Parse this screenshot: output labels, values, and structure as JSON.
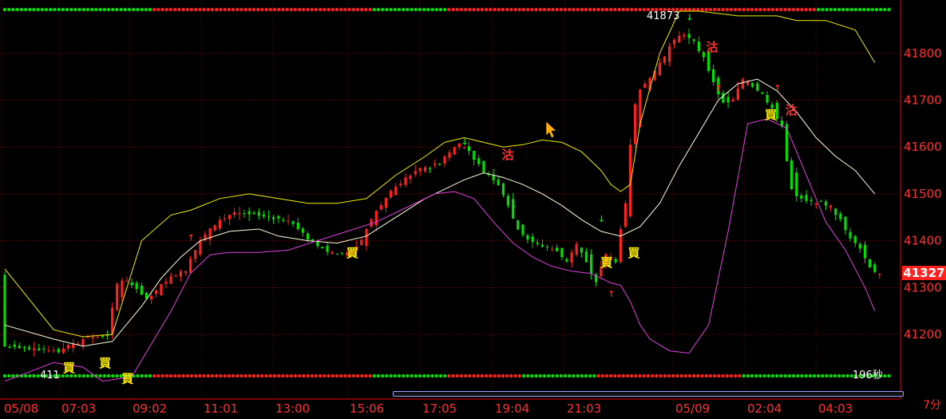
{
  "chart_data": {
    "type": "candlestick",
    "timeframe": "7分",
    "last_price": "41327",
    "high_label": "41873",
    "low_label": "411",
    "right_bottom_label": "196秒",
    "y_ticks": [
      41200,
      41300,
      41400,
      41500,
      41600,
      41700,
      41800
    ],
    "ylim": [
      41120,
      41890
    ],
    "x_ticks": [
      "05/08",
      "07:03",
      "09:02",
      "11:01",
      "13:00",
      "15:06",
      "17:05",
      "19:04",
      "21:03",
      "05/09",
      "02:04",
      "04:03"
    ],
    "close_path": [
      [
        0,
        41175
      ],
      [
        4,
        41170
      ],
      [
        6,
        41165
      ],
      [
        9,
        41195
      ],
      [
        11,
        41195
      ],
      [
        12,
        41320
      ],
      [
        14,
        41300
      ],
      [
        15,
        41270
      ],
      [
        17,
        41320
      ],
      [
        19,
        41340
      ],
      [
        20,
        41385
      ],
      [
        22,
        41440
      ],
      [
        24,
        41460
      ],
      [
        26,
        41455
      ],
      [
        28,
        41450
      ],
      [
        30,
        41440
      ],
      [
        31,
        41410
      ],
      [
        32,
        41395
      ],
      [
        34,
        41370
      ],
      [
        36,
        41375
      ],
      [
        37,
        41400
      ],
      [
        38,
        41450
      ],
      [
        40,
        41505
      ],
      [
        42,
        41545
      ],
      [
        44,
        41560
      ],
      [
        45,
        41570
      ],
      [
        47,
        41610
      ],
      [
        48,
        41590
      ],
      [
        49,
        41555
      ],
      [
        51,
        41520
      ],
      [
        52,
        41475
      ],
      [
        53,
        41420
      ],
      [
        55,
        41390
      ],
      [
        57,
        41380
      ],
      [
        58,
        41350
      ],
      [
        59,
        41400
      ],
      [
        60,
        41350
      ],
      [
        61,
        41310
      ],
      [
        62,
        41380
      ],
      [
        63,
        41350
      ],
      [
        64,
        41500
      ],
      [
        65,
        41710
      ],
      [
        67,
        41760
      ],
      [
        68,
        41800
      ],
      [
        69,
        41830
      ],
      [
        70,
        41845
      ],
      [
        71,
        41820
      ],
      [
        72,
        41790
      ],
      [
        73,
        41735
      ],
      [
        74,
        41690
      ],
      [
        75,
        41700
      ],
      [
        76,
        41750
      ],
      [
        77,
        41730
      ],
      [
        78,
        41710
      ],
      [
        79,
        41680
      ],
      [
        80,
        41640
      ],
      [
        81,
        41500
      ],
      [
        82,
        41490
      ],
      [
        83,
        41480
      ],
      [
        84,
        41480
      ],
      [
        85,
        41470
      ],
      [
        86,
        41440
      ],
      [
        87,
        41405
      ],
      [
        88,
        41385
      ],
      [
        89,
        41340
      ],
      [
        90,
        41327
      ]
    ],
    "bollinger_upper": [
      [
        0,
        41340
      ],
      [
        5,
        41210
      ],
      [
        8,
        41195
      ],
      [
        11,
        41200
      ],
      [
        14,
        41400
      ],
      [
        17,
        41455
      ],
      [
        19,
        41465
      ],
      [
        22,
        41490
      ],
      [
        25,
        41500
      ],
      [
        28,
        41490
      ],
      [
        31,
        41480
      ],
      [
        34,
        41480
      ],
      [
        37,
        41490
      ],
      [
        40,
        41540
      ],
      [
        43,
        41580
      ],
      [
        45,
        41610
      ],
      [
        47,
        41620
      ],
      [
        49,
        41610
      ],
      [
        51,
        41600
      ],
      [
        53,
        41605
      ],
      [
        55,
        41615
      ],
      [
        57,
        41610
      ],
      [
        59,
        41590
      ],
      [
        61,
        41550
      ],
      [
        62,
        41520
      ],
      [
        63,
        41505
      ],
      [
        64,
        41520
      ],
      [
        65,
        41650
      ],
      [
        67,
        41800
      ],
      [
        69,
        41890
      ],
      [
        71,
        41890
      ],
      [
        73,
        41885
      ],
      [
        75,
        41880
      ],
      [
        77,
        41880
      ],
      [
        79,
        41880
      ],
      [
        81,
        41870
      ],
      [
        84,
        41870
      ],
      [
        87,
        41850
      ],
      [
        89,
        41780
      ]
    ],
    "bollinger_middle": [
      [
        0,
        41220
      ],
      [
        5,
        41190
      ],
      [
        8,
        41175
      ],
      [
        11,
        41185
      ],
      [
        14,
        41260
      ],
      [
        16,
        41320
      ],
      [
        18,
        41365
      ],
      [
        20,
        41400
      ],
      [
        23,
        41420
      ],
      [
        26,
        41425
      ],
      [
        28,
        41410
      ],
      [
        31,
        41400
      ],
      [
        34,
        41395
      ],
      [
        37,
        41410
      ],
      [
        40,
        41450
      ],
      [
        43,
        41490
      ],
      [
        45,
        41510
      ],
      [
        47,
        41530
      ],
      [
        49,
        41545
      ],
      [
        51,
        41535
      ],
      [
        53,
        41520
      ],
      [
        55,
        41500
      ],
      [
        57,
        41475
      ],
      [
        59,
        41445
      ],
      [
        61,
        41420
      ],
      [
        63,
        41410
      ],
      [
        65,
        41430
      ],
      [
        67,
        41480
      ],
      [
        69,
        41560
      ],
      [
        71,
        41630
      ],
      [
        73,
        41700
      ],
      [
        75,
        41735
      ],
      [
        77,
        41745
      ],
      [
        79,
        41720
      ],
      [
        81,
        41675
      ],
      [
        83,
        41620
      ],
      [
        85,
        41580
      ],
      [
        87,
        41550
      ],
      [
        89,
        41500
      ]
    ],
    "bollinger_lower": [
      [
        0,
        41100
      ],
      [
        5,
        41140
      ],
      [
        8,
        41130
      ],
      [
        10,
        41100
      ],
      [
        13,
        41110
      ],
      [
        15,
        41180
      ],
      [
        17,
        41250
      ],
      [
        19,
        41330
      ],
      [
        21,
        41370
      ],
      [
        23,
        41375
      ],
      [
        26,
        41375
      ],
      [
        29,
        41380
      ],
      [
        32,
        41400
      ],
      [
        35,
        41420
      ],
      [
        38,
        41440
      ],
      [
        41,
        41470
      ],
      [
        44,
        41500
      ],
      [
        46,
        41505
      ],
      [
        48,
        41490
      ],
      [
        50,
        41440
      ],
      [
        52,
        41395
      ],
      [
        54,
        41365
      ],
      [
        56,
        41345
      ],
      [
        58,
        41335
      ],
      [
        60,
        41330
      ],
      [
        62,
        41310
      ],
      [
        63,
        41305
      ],
      [
        64,
        41270
      ],
      [
        65,
        41220
      ],
      [
        66,
        41190
      ],
      [
        68,
        41165
      ],
      [
        70,
        41160
      ],
      [
        72,
        41220
      ],
      [
        74,
        41420
      ],
      [
        76,
        41650
      ],
      [
        78,
        41660
      ],
      [
        80,
        41640
      ],
      [
        82,
        41540
      ],
      [
        84,
        41440
      ],
      [
        86,
        41380
      ],
      [
        88,
        41300
      ],
      [
        89,
        41250
      ]
    ],
    "signals": [
      {
        "type": "buy",
        "label": "買",
        "x": 6.6,
        "y": 41120
      },
      {
        "type": "buy",
        "label": "買",
        "x": 10.3,
        "y": 41130
      },
      {
        "type": "buy",
        "label": "買",
        "x": 12.6,
        "y": 41097
      },
      {
        "type": "buy",
        "label": "買",
        "x": 35.6,
        "y": 41365
      },
      {
        "type": "buy",
        "label": "買",
        "x": 61.6,
        "y": 41345
      },
      {
        "type": "buy",
        "label": "買",
        "x": 64.4,
        "y": 41365
      },
      {
        "type": "buy",
        "label": "買",
        "x": 78.4,
        "y": 41660
      },
      {
        "type": "sell",
        "label": "沽",
        "x": 51.5,
        "y": 41575
      },
      {
        "type": "sell",
        "label": "沽",
        "x": 72.4,
        "y": 41805
      },
      {
        "type": "sell",
        "label": "沽",
        "x": 80.5,
        "y": 41670
      }
    ]
  },
  "ui": {
    "timeframe_label": "7分",
    "price_axis_label": "41327"
  }
}
